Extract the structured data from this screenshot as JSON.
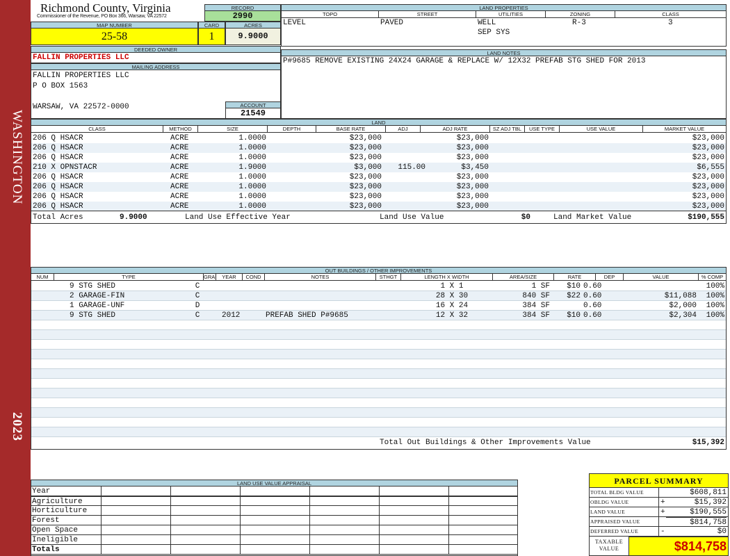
{
  "sidebar": {
    "district": "WASHINGTON",
    "year": "2023"
  },
  "header": {
    "county": "Richmond County, Virginia",
    "address": "Commissioner of the Revenue, PO Box 366, Warsaw, VA 22572",
    "record_label": "RECORD",
    "record_value": "2990",
    "map_label": "MAP NUMBER",
    "map_value": "25-58",
    "card_label": "CARD",
    "card_value": "1",
    "acres_label": "ACRES",
    "acres_value": "9.9000"
  },
  "land_properties": {
    "title": "LAND PROPERTIES",
    "cols": [
      "TOPO",
      "STREET",
      "UTILITIES",
      "ZONING",
      "CLASS"
    ],
    "topo": "LEVEL",
    "street": "PAVED",
    "utilities1": "WELL",
    "utilities2": "SEP SYS",
    "zoning": "R-3",
    "class": "3"
  },
  "owner": {
    "deeded_label": "DEEDED OWNER",
    "deeded_name": "FALLIN PROPERTIES LLC",
    "mailing_label": "MAILING ADDRESS",
    "line1": "FALLIN PROPERTIES LLC",
    "line2": "P O BOX 1563",
    "line3": "WARSAW, VA 22572-0000",
    "account_label": "ACCOUNT",
    "account_value": "21549"
  },
  "land_notes": {
    "title": "LAND NOTES",
    "text": "P#9685 REMOVE EXISTING 24X24 GARAGE & REPLACE W/ 12X32 PREFAB STG SHED FOR 2013"
  },
  "land": {
    "title": "LAND",
    "cols": [
      "CLASS",
      "METHOD",
      "SIZE",
      "DEPTH",
      "BASE RATE",
      "ADJ",
      "ADJ RATE",
      "SZ ADJ TBL",
      "USE TYPE",
      "USE VALUE",
      "MARKET VALUE"
    ],
    "rows": [
      {
        "class": "206 Q HSACR",
        "method": "ACRE",
        "size": "1.0000",
        "base": "$23,000",
        "adj": "",
        "adj_rate": "$23,000",
        "market": "$23,000"
      },
      {
        "class": "206 Q HSACR",
        "method": "ACRE",
        "size": "1.0000",
        "base": "$23,000",
        "adj": "",
        "adj_rate": "$23,000",
        "market": "$23,000"
      },
      {
        "class": "206 Q HSACR",
        "method": "ACRE",
        "size": "1.0000",
        "base": "$23,000",
        "adj": "",
        "adj_rate": "$23,000",
        "market": "$23,000"
      },
      {
        "class": "210 X OPNSTACR",
        "method": "ACRE",
        "size": "1.9000",
        "base": "$3,000",
        "adj": "115.00",
        "adj_rate": "$3,450",
        "market": "$6,555"
      },
      {
        "class": "206 Q HSACR",
        "method": "ACRE",
        "size": "1.0000",
        "base": "$23,000",
        "adj": "",
        "adj_rate": "$23,000",
        "market": "$23,000"
      },
      {
        "class": "206 Q HSACR",
        "method": "ACRE",
        "size": "1.0000",
        "base": "$23,000",
        "adj": "",
        "adj_rate": "$23,000",
        "market": "$23,000"
      },
      {
        "class": "206 Q HSACR",
        "method": "ACRE",
        "size": "1.0000",
        "base": "$23,000",
        "adj": "",
        "adj_rate": "$23,000",
        "market": "$23,000"
      },
      {
        "class": "206 Q HSACR",
        "method": "ACRE",
        "size": "1.0000",
        "base": "$23,000",
        "adj": "",
        "adj_rate": "$23,000",
        "market": "$23,000"
      }
    ],
    "total_acres_label": "Total Acres",
    "total_acres": "9.9000",
    "effective_label": "Land Use Effective Year",
    "use_value_label": "Land Use Value",
    "use_value": "$0",
    "market_label": "Land Market Value",
    "market_value": "$190,555"
  },
  "outbuildings": {
    "title": "OUT BUILDINGS / OTHER IMPROVEMENTS",
    "cols": [
      "NUM",
      "TYPE",
      "GRADE",
      "YEAR",
      "COND",
      "NOTES",
      "STHGT",
      "LENGTH X WIDTH",
      "AREA/SIZE",
      "RATE",
      "DEP",
      "VALUE",
      "% COMP"
    ],
    "rows": [
      {
        "type": "9 STG SHED",
        "grade": "C",
        "year": "",
        "notes": "",
        "dims": "1 X 1",
        "area": "1 SF",
        "rate": "$10",
        "dep": "0.60",
        "value": "",
        "comp": "100%"
      },
      {
        "type": "2 GARAGE-FIN",
        "grade": "C",
        "year": "",
        "notes": "",
        "dims": "28 X 30",
        "area": "840 SF",
        "rate": "$22",
        "dep": "0.60",
        "value": "$11,088",
        "comp": "100%"
      },
      {
        "type": "1 GARAGE-UNF",
        "grade": "D",
        "year": "",
        "notes": "",
        "dims": "16 X 24",
        "area": "384 SF",
        "rate": "",
        "dep": "0.60",
        "value": "$2,000",
        "comp": "100%"
      },
      {
        "type": "9 STG SHED",
        "grade": "C",
        "year": "2012",
        "notes": "PREFAB SHED P#9685",
        "dims": "12 X 32",
        "area": "384 SF",
        "rate": "$10",
        "dep": "0.60",
        "value": "$2,304",
        "comp": "100%"
      }
    ],
    "total_label": "Total Out Buildings & Other Improvements Value",
    "total_value": "$15,392"
  },
  "land_use_appraisal": {
    "title": "LAND USE VALUE APPRAISAL",
    "rows": [
      "Year",
      "Agriculture",
      "Horticulture",
      "Forest",
      "Open Space",
      "Ineligible",
      "Totals"
    ]
  },
  "parcel_summary": {
    "title": "PARCEL SUMMARY",
    "rows": [
      {
        "label": "TOTAL BLDG VALUE",
        "op": "",
        "value": "$608,811"
      },
      {
        "label": "OBLDG VALUE",
        "op": "+",
        "value": "$15,392"
      },
      {
        "label": "LAND VALUE",
        "op": "+",
        "value": "$190,555"
      },
      {
        "label": "APPRAISED VALUE",
        "op": "",
        "value": "$814,758"
      },
      {
        "label": "DEFERRED VALUE",
        "op": "-",
        "value": "$0"
      }
    ],
    "taxable_label_1": "TAXABLE",
    "taxable_label_2": "VALUE",
    "taxable_value": "$814,758"
  },
  "colors": {
    "sidebar": "#a52a2a",
    "header_band": "#b0d4e0",
    "yellow": "#ffff00",
    "green": "#a8e09a",
    "owner_red": "#cc0000"
  }
}
